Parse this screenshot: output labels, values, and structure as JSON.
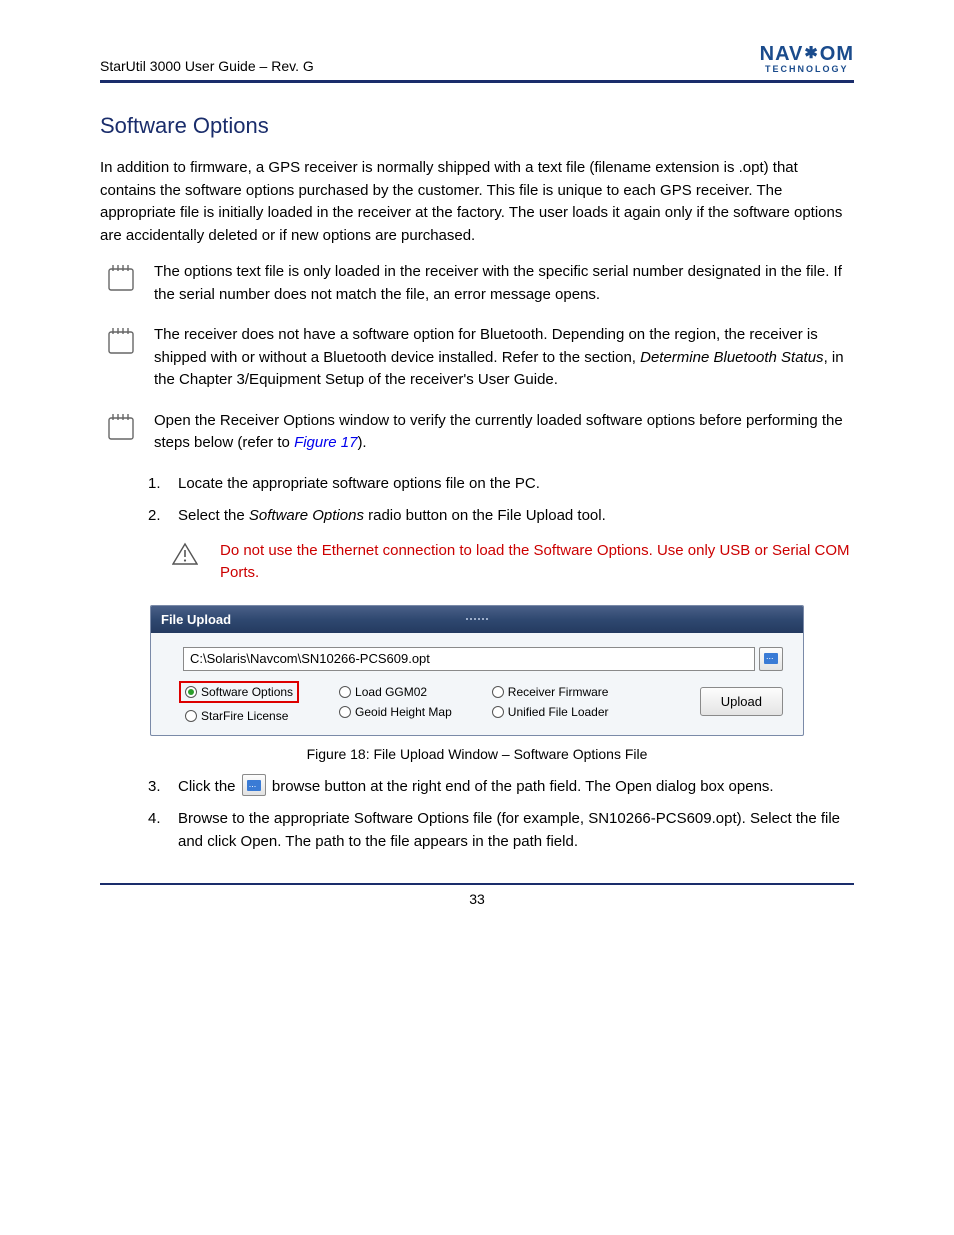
{
  "header": {
    "product": "StarUtil 3000 User Guide",
    "rev": "Rev. G"
  },
  "logo": {
    "top_left": "NAV",
    "top_right": "OM",
    "bottom": "TECHNOLOGY"
  },
  "section": {
    "title": "Software Options"
  },
  "para1": "In addition to firmware, a GPS receiver is normally shipped with a text file (filename extension is .opt) that contains the software options purchased by the customer. This file is unique to each GPS receiver. The appropriate file is initially loaded in the receiver at the factory. The user loads it again only if the software options are accidentally deleted or if new options are purchased.",
  "note1": "The options text file is only loaded in the receiver with the specific serial number designated in the file. If the serial number does not match the file, an error message opens.",
  "note2_a": "The receiver does not have a software option for Bluetooth. Depending on the region, the receiver is shipped with or without a Bluetooth device installed. Refer to the section, ",
  "note2_b": "Determine Bluetooth Status",
  "note2_c": ", in the Chapter 3/Equipment Setup of the receiver's User Guide.",
  "note3": "Open the Receiver Options window to verify the currently loaded software options before performing the steps below (refer to ",
  "note3_link": "Figure 17",
  "note3_after": ").",
  "list": {
    "n1": "1.",
    "t1": "Locate the appropriate software options file on the PC.",
    "n2": "2.",
    "t2": "Select the ",
    "t2_b": "Software Options",
    "t2_c": " radio button on the File Upload tool.",
    "n3": "3.",
    "t3a": "Click the ",
    "t3b": " browse button at the right end of the path field. The Open dialog box opens.",
    "n4": "4.",
    "t4": "Browse to the appropriate Software Options file (for example, SN10266-PCS609.opt). Select the file and click Open. The path to the file appears in the path field."
  },
  "warn": "Do not use the Ethernet connection to load the Software Options. Use only USB or Serial COM Ports.",
  "file_upload": {
    "title": "File Upload",
    "path": "C:\\Solaris\\Navcom\\SN10266-PCS609.opt",
    "opts": {
      "software_options": "Software Options",
      "starfire_license": "StarFire License",
      "load_ggm02": "Load GGM02",
      "geoid_height_map": "Geoid Height Map",
      "receiver_firmware": "Receiver Firmware",
      "unified_file_loader": "Unified File Loader"
    },
    "upload": "Upload"
  },
  "caption": "Figure 18: File Upload Window – Software Options File",
  "footer": "33"
}
